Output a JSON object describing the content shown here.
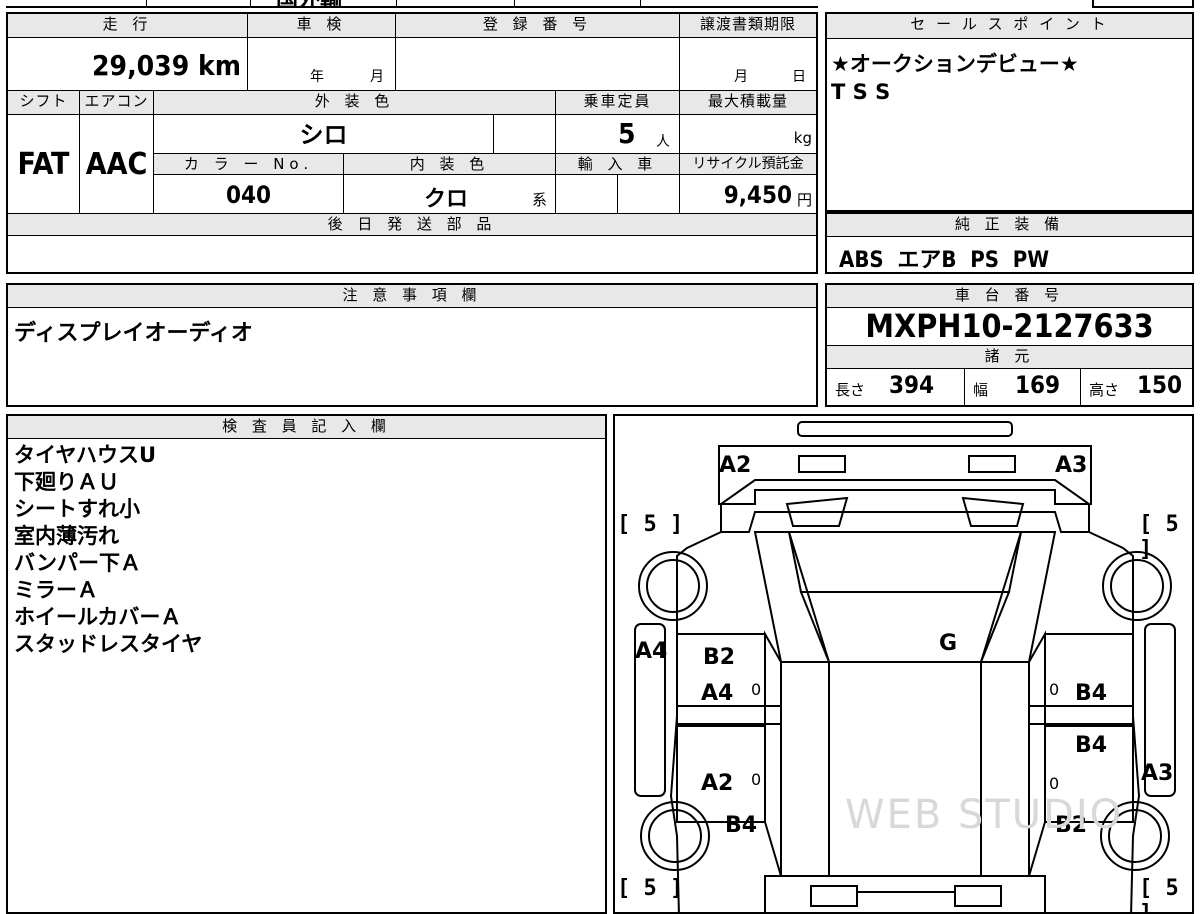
{
  "top_fragments": {
    "left_text": "国外輸",
    "mid_text": "ⅹ"
  },
  "mileage": {
    "label": "走 行",
    "value": "29,039 km"
  },
  "inspection": {
    "label": "車 検",
    "year": "年",
    "month": "月"
  },
  "registration": {
    "label": "登 録 番 号",
    "value": ""
  },
  "transfer": {
    "label": "譲渡書類期限",
    "month": "月",
    "day": "日"
  },
  "shift": {
    "label": "シフト",
    "value": "FAT"
  },
  "ac": {
    "label": "エアコン",
    "value": "AAC"
  },
  "exterior": {
    "label": "外 装 色",
    "value": "シロ"
  },
  "capacity": {
    "label": "乗車定員",
    "value": "5",
    "unit": "人"
  },
  "max_load": {
    "label": "最大積載量",
    "unit": "kg"
  },
  "color_no": {
    "label": "カ ラ ー No.",
    "value": "040"
  },
  "interior": {
    "label": "内 装 色",
    "value": "クロ",
    "suffix": "系"
  },
  "import": {
    "label": "輸 入 車"
  },
  "recycle": {
    "label": "リサイクル預託金",
    "value": "9,450",
    "unit": "円"
  },
  "later_parts": {
    "label": "後 日 発 送 部 品"
  },
  "sales_points": {
    "label": "セ ー ル ス ポ イ ン ト",
    "lines": [
      "★オークションデビュー★",
      "T S S"
    ]
  },
  "genuine": {
    "label": "純 正 装 備",
    "value": "ABS  エアB  PS  PW"
  },
  "notes": {
    "label": "注 意 事 項 欄",
    "text": "ディスプレイオーディオ"
  },
  "chassis": {
    "label": "車 台 番 号",
    "value": "MXPH10-2127633"
  },
  "specs": {
    "label": "諸 元",
    "length_label": "長さ",
    "length": "394",
    "width_label": "幅",
    "width": "169",
    "height_label": "高さ",
    "height": "150"
  },
  "inspector": {
    "label": "検 査 員 記 入 欄",
    "lines": [
      "タイヤハウスU",
      "下廻りＡＵ",
      "シートすれ小",
      "室内薄汚れ",
      "バンパー下Ａ",
      "ミラーＡ",
      "ホイールカバーＡ",
      "スタッドレスタイヤ"
    ]
  },
  "diagram": {
    "marks": {
      "a2_top": "A2",
      "a3_top": "A3",
      "g": "G",
      "a4_side": "A4",
      "b2_front_left": "B2",
      "a4_door": "A4",
      "a2_rear_left": "A2",
      "b4_rear_left": "B4",
      "b4_front_right": "B4",
      "b4_rear_right": "B4",
      "a3_side": "A3",
      "b2_rear_right": "B2"
    },
    "tires": {
      "fl": "[ 5 ]",
      "fr": "[ 5 ]",
      "rl": "[ 5 ]",
      "rr": "[ 5 ]"
    },
    "zeros": {
      "z1": "0",
      "z2": "0",
      "z3": "0",
      "z4": "0"
    },
    "watermark": "WEB STUDIO"
  }
}
